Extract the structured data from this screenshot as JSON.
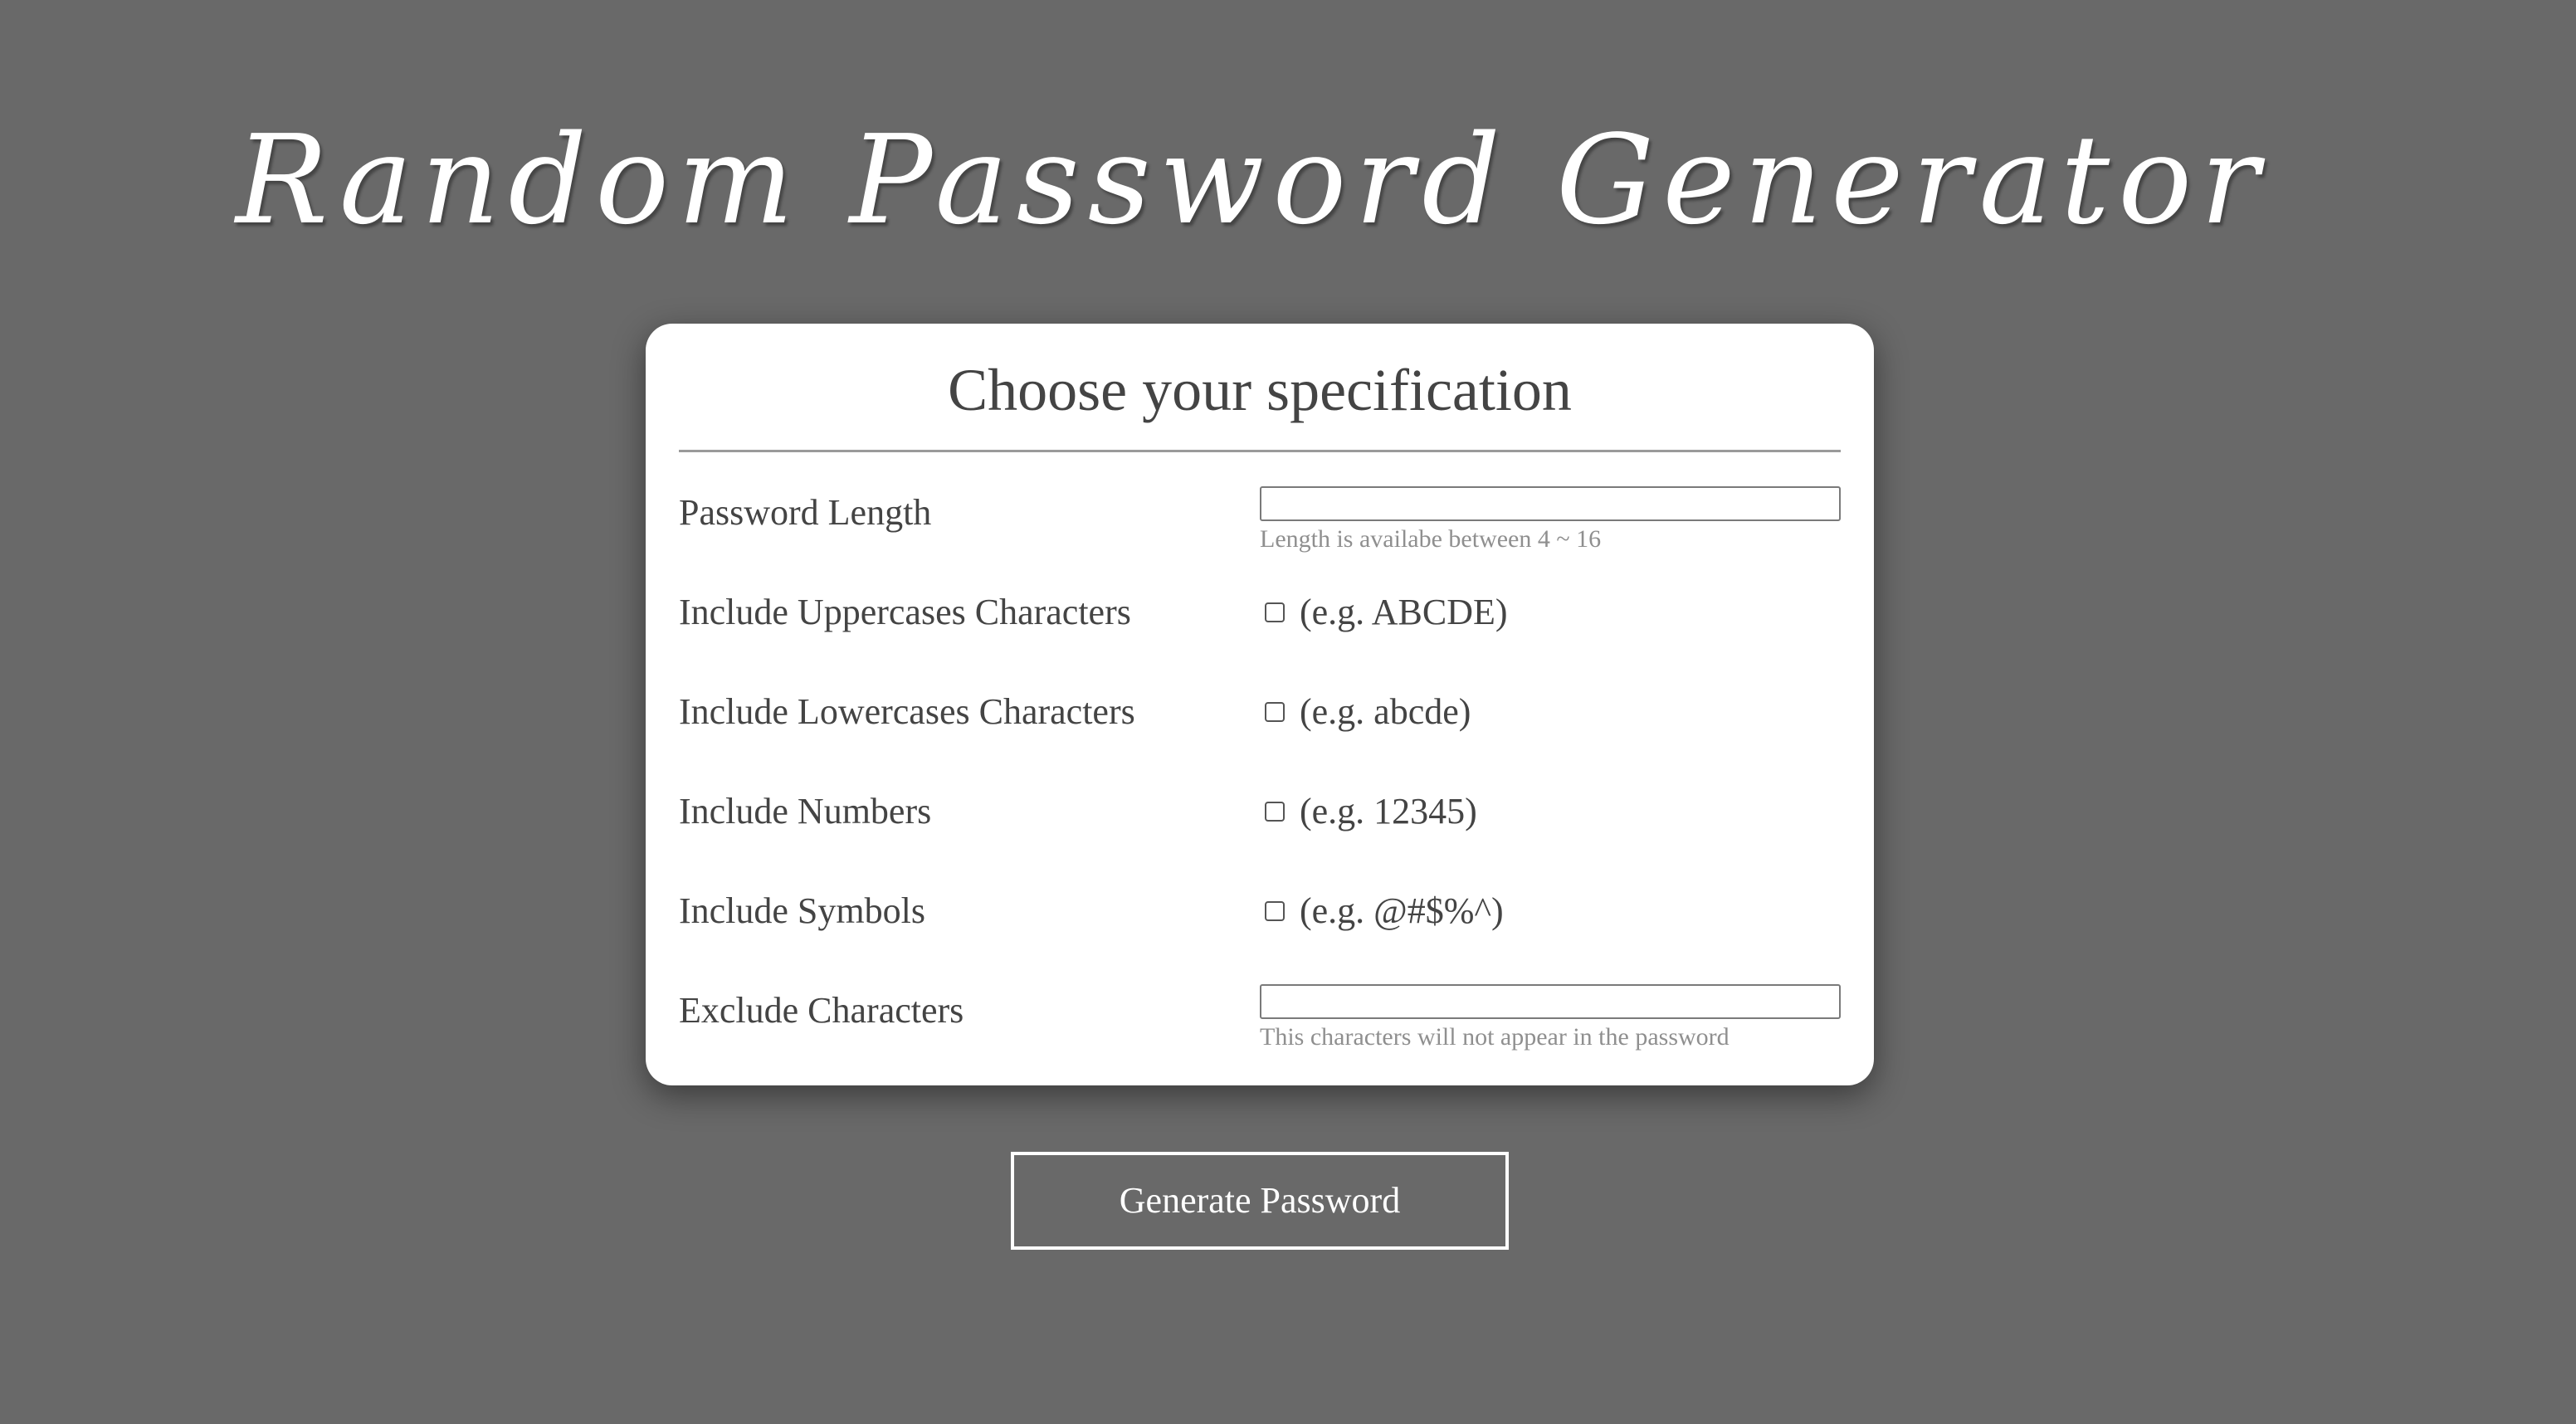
{
  "page": {
    "title": "Random Password Generator"
  },
  "card": {
    "title": "Choose your specification",
    "rows": {
      "length": {
        "label": "Password Length",
        "value": "",
        "hint": "Length is availabe between 4 ~ 16"
      },
      "uppercase": {
        "label": "Include Uppercases Characters",
        "example": "(e.g. ABCDE)",
        "checked": false
      },
      "lowercase": {
        "label": "Include Lowercases Characters",
        "example": "(e.g. abcde)",
        "checked": false
      },
      "numbers": {
        "label": "Include Numbers",
        "example": "(e.g. 12345)",
        "checked": false
      },
      "symbols": {
        "label": "Include Symbols",
        "example": "(e.g. @#$%^)",
        "checked": false
      },
      "exclude": {
        "label": "Exclude Characters",
        "value": "",
        "hint": "This characters will not appear in the password"
      }
    }
  },
  "actions": {
    "generate_label": "Generate Password"
  },
  "colors": {
    "background": "#696969",
    "card": "#ffffff",
    "text": "#444444",
    "hint": "#8f8f8f"
  }
}
